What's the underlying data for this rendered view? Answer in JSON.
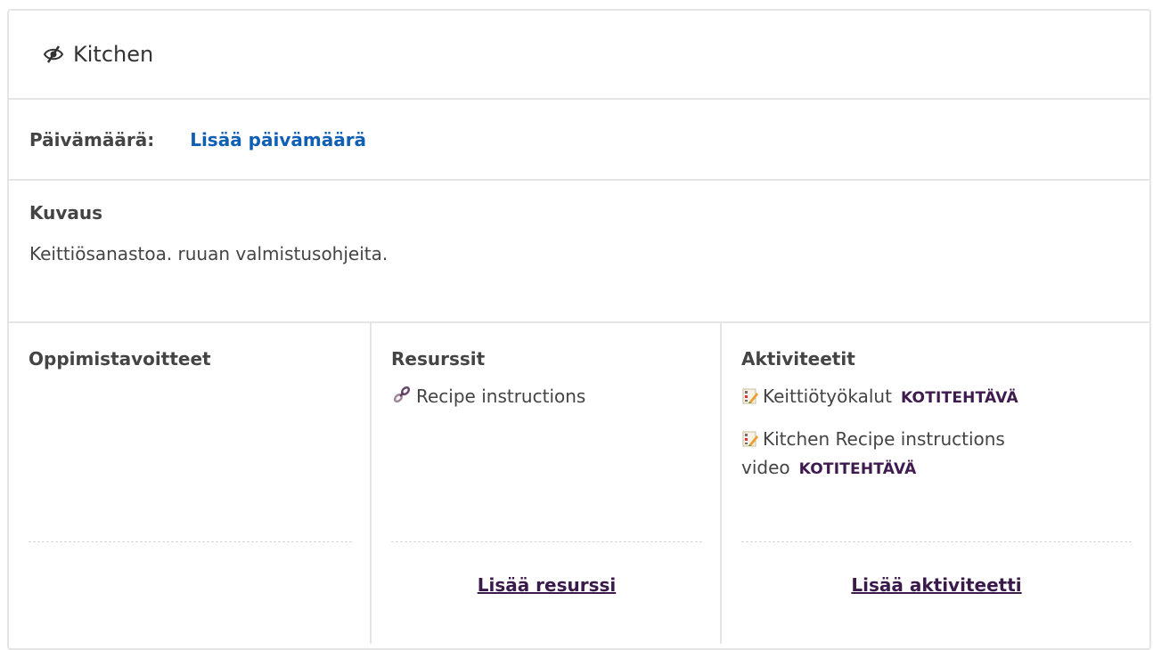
{
  "header": {
    "title": "Kitchen",
    "icon": "eye-slash-icon"
  },
  "date": {
    "label": "Päivämäärä:",
    "link": "Lisää päivämäärä"
  },
  "description": {
    "title": "Kuvaus",
    "text": "Keittiösanastoa. ruuan valmistusohjeita."
  },
  "columns": {
    "objectives": {
      "title": "Oppimistavoitteet"
    },
    "resources": {
      "title": "Resurssit",
      "items": [
        {
          "label": "Recipe instructions",
          "icon": "link-icon"
        }
      ],
      "add_label": "Lisää resurssi"
    },
    "activities": {
      "title": "Aktiviteetit",
      "items": [
        {
          "label": "Keittiötyökalut",
          "badge": "KOTITEHTÄVÄ",
          "icon": "assignment-icon"
        },
        {
          "label": "Kitchen Recipe instructions video",
          "badge": "KOTITEHTÄVÄ",
          "icon": "assignment-icon"
        }
      ],
      "add_label": "Lisää aktiviteetti"
    }
  },
  "colors": {
    "link_blue": "#0f5fb5",
    "badge_purple": "#3e1a4f",
    "border": "#e5e5e5"
  }
}
